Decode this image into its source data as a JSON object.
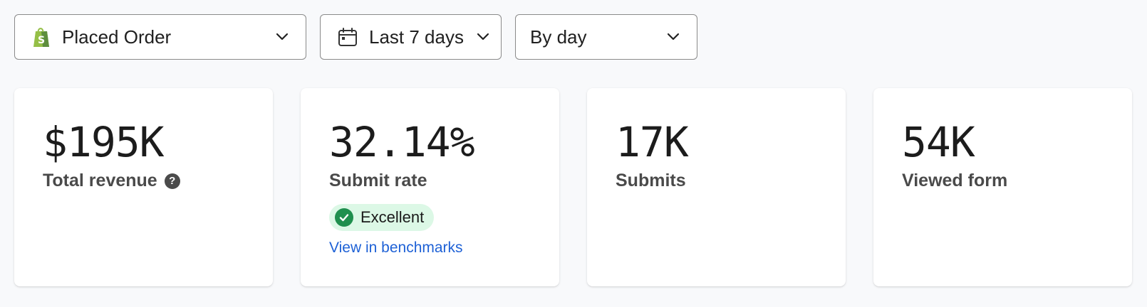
{
  "filters": {
    "metric": {
      "label": "Placed Order",
      "icon": "shopify-bag-icon"
    },
    "date_range": {
      "label": "Last 7 days",
      "icon": "calendar-icon"
    },
    "grouping": {
      "label": "By day"
    }
  },
  "cards": [
    {
      "value": "$195K",
      "label": "Total revenue",
      "help": "?"
    },
    {
      "value": "32.14%",
      "label": "Submit rate",
      "badge": "Excellent",
      "link": "View in benchmarks"
    },
    {
      "value": "17K",
      "label": "Submits"
    },
    {
      "value": "54K",
      "label": "Viewed form"
    }
  ],
  "colors": {
    "background": "#f8f9fb",
    "shopify_green": "#95bf47",
    "badge_bg": "#dcf8e6",
    "badge_check": "#1f8f4e",
    "link": "#1e61d6"
  }
}
